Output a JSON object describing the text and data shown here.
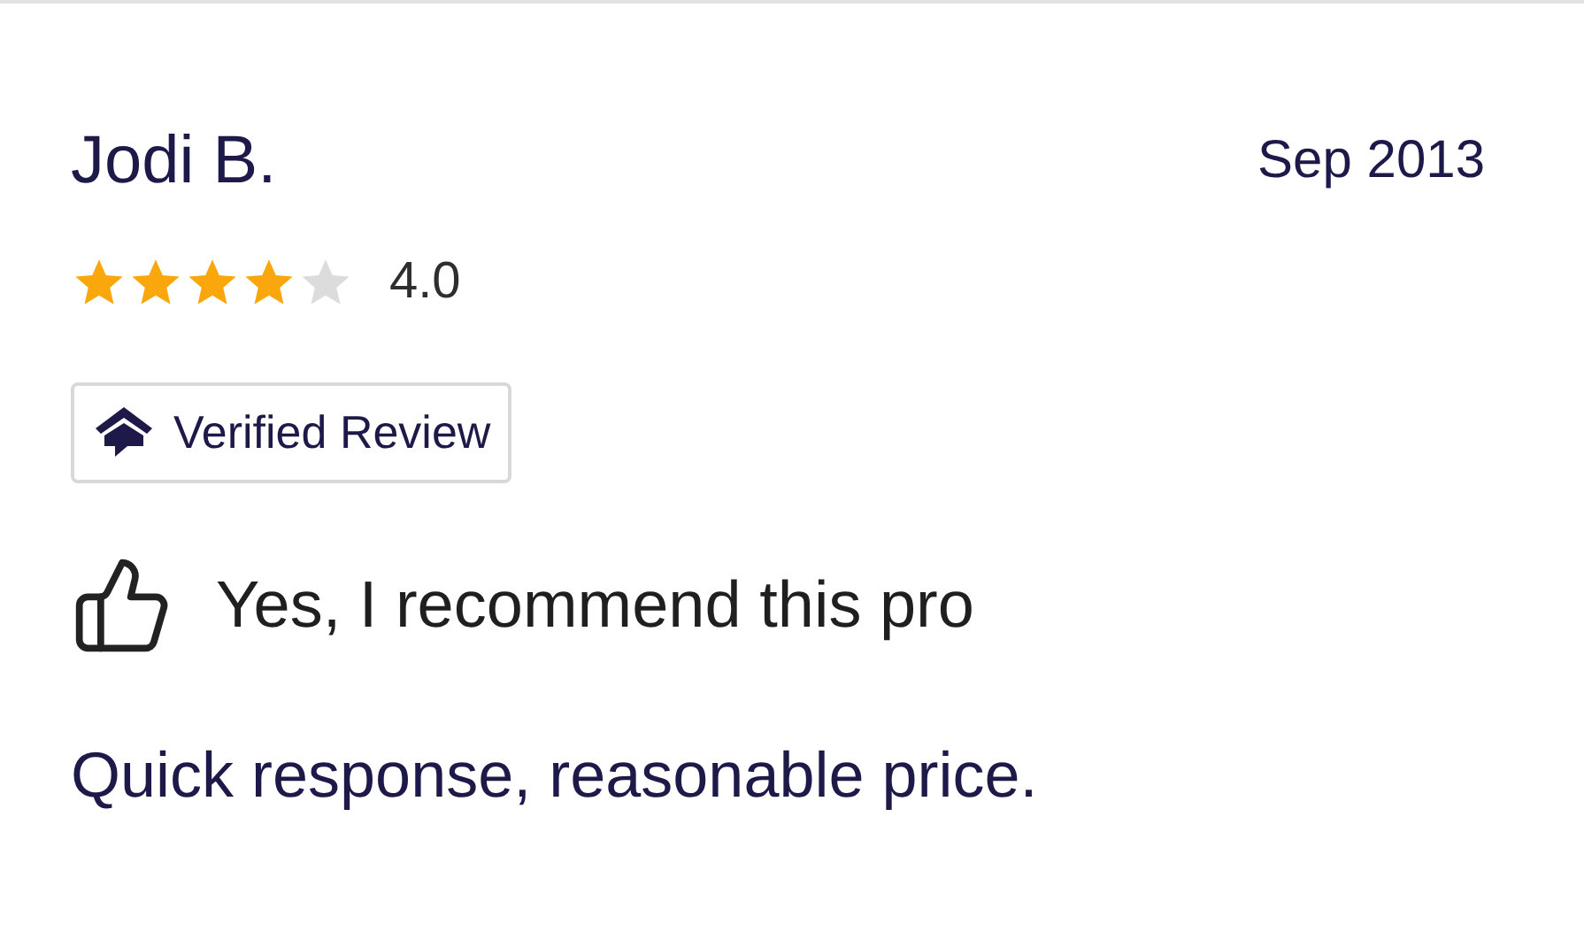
{
  "review": {
    "name": "Jodi B.",
    "date": "Sep 2013",
    "stars": 4,
    "rating": "4.0",
    "badge": "Verified Review",
    "recommendation": "Yes, I recommend this pro",
    "text": "Quick response, reasonable price."
  }
}
